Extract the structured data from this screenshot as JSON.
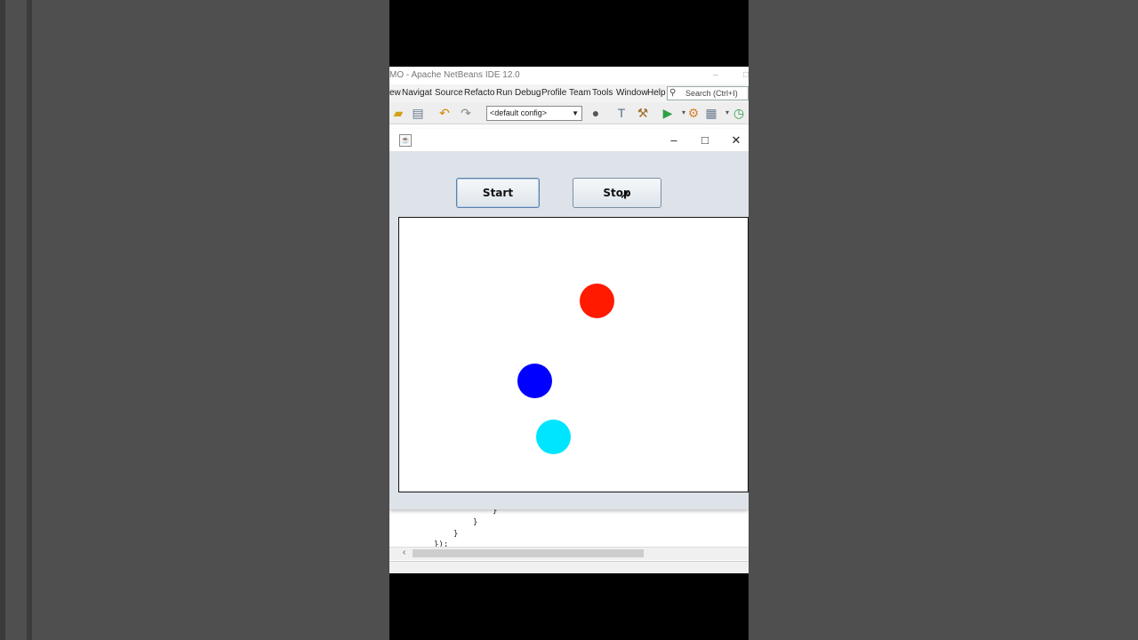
{
  "ide": {
    "title": "MO - Apache NetBeans IDE 12.0",
    "menu": [
      "ew",
      "Navigat",
      "Source",
      "Refacto",
      "Run",
      "Debug",
      "Profile",
      "Team",
      "Tools",
      "Window",
      "Help"
    ],
    "search_placeholder": "Search (Ctrl+I)",
    "config": "<default config>",
    "code_lines": [
      "}",
      "}",
      "}",
      "});"
    ]
  },
  "app": {
    "start_label": "Start",
    "stop_label": "Stop",
    "balls": [
      {
        "name": "red",
        "color": "#ff1a00"
      },
      {
        "name": "blue",
        "color": "#0000ff"
      },
      {
        "name": "cyan",
        "color": "#00e5ff"
      }
    ]
  },
  "icons": {
    "search": "search-icon",
    "window_minimize": "minimize-icon",
    "window_maximize": "maximize-icon",
    "window_close": "close-icon",
    "app": "java-icon"
  }
}
